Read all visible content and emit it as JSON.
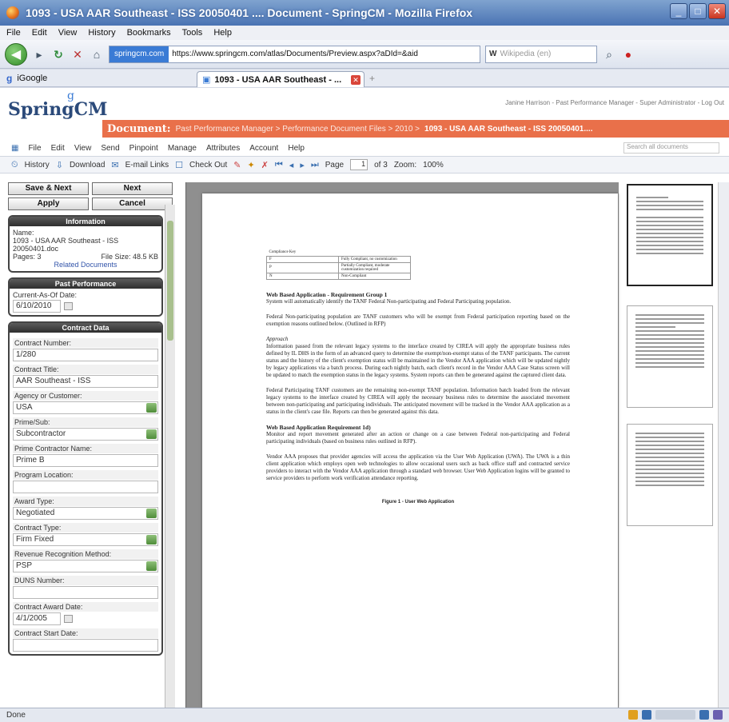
{
  "window": {
    "title": "1093 - USA AAR Southeast - ISS 20050401 .... Document - SpringCM - Mozilla Firefox"
  },
  "menu": [
    "File",
    "Edit",
    "View",
    "History",
    "Bookmarks",
    "Tools",
    "Help"
  ],
  "nav": {
    "site_identity": "springcm.com",
    "url": "https://www.springcm.com/atlas/Documents/Preview.aspx?aDId=&aid",
    "search_engine_letter": "W",
    "search_placeholder": "Wikipedia (en)"
  },
  "bookmarks": {
    "google_label": "iGoogle"
  },
  "tab": {
    "label": "1093 - USA AAR Southeast - ...",
    "new_tab": "+"
  },
  "app": {
    "user_links": "Janine Harrison - Past Performance Manager - Super Administrator - Log Out",
    "logo": "SpringCM",
    "logo_mark": "g",
    "crumb_label": "Document:",
    "crumb_path": "Past Performance Manager > Performance Document Files > 2010 > ",
    "crumb_current": "1093 - USA AAR Southeast - ISS 20050401....",
    "menu": [
      "File",
      "Edit",
      "View",
      "Send",
      "Pinpoint",
      "Manage",
      "Attributes",
      "Account",
      "Help"
    ],
    "quicksearch_placeholder": "Search all documents",
    "toolbar": {
      "history": "History",
      "download": "Download",
      "email": "E-mail Links",
      "checkout": "Check Out",
      "page_label": "Page",
      "page_value": "1",
      "page_of": "of 3",
      "zoom_label": "Zoom:",
      "zoom_value": "100%"
    }
  },
  "sidebar": {
    "save_next": "Save & Next",
    "next": "Next",
    "apply": "Apply",
    "cancel": "Cancel",
    "info_head": "Information",
    "name_label": "Name:",
    "name_value": "1093 - USA AAR Southeast - ISS 20050401.doc",
    "pages_label": "Pages: 3",
    "file_size": "File Size: 48.5 KB",
    "related": "Related Documents",
    "pp_head": "Past Performance",
    "current_as_of_label": "Current-As-Of Date:",
    "current_as_of_value": "6/10/2010",
    "cd_head": "Contract Data",
    "fields": [
      {
        "label": "Contract Number:",
        "value": "1/280",
        "dropdown": false
      },
      {
        "label": "Contract Title:",
        "value": "AAR Southeast - ISS",
        "dropdown": false
      },
      {
        "label": "Agency or Customer:",
        "value": "USA",
        "dropdown": true
      },
      {
        "label": "Prime/Sub:",
        "value": "Subcontractor",
        "dropdown": true
      },
      {
        "label": "Prime Contractor Name:",
        "value": "Prime B",
        "dropdown": false
      },
      {
        "label": "Program Location:",
        "value": "",
        "dropdown": false
      },
      {
        "label": "Award Type:",
        "value": "Negotiated",
        "dropdown": true
      },
      {
        "label": "Contract Type:",
        "value": "Firm Fixed",
        "dropdown": true
      },
      {
        "label": "Revenue Recognition Method:",
        "value": "PSP",
        "dropdown": true
      },
      {
        "label": "DUNS Number:",
        "value": "",
        "dropdown": false
      },
      {
        "label": "Contract Award Date:",
        "value": "4/1/2005",
        "dropdown": false
      },
      {
        "label": "Contract Start Date:",
        "value": "",
        "dropdown": false
      }
    ]
  },
  "document": {
    "table_head": "Compliance Key",
    "table_rows": [
      [
        "F",
        "Fully Compliant, no customization"
      ],
      [
        "P",
        "Partially Compliant, moderate customization required"
      ],
      [
        "N",
        "Non-Compliant"
      ]
    ],
    "h1": "Web Based Application - Requirement Group 1",
    "p1": "System will automatically identify the TANF Federal Non-participating and Federal Participating population.",
    "p2": "Federal Non-participating population are TANF customers who will be exempt from Federal participation reporting based on the exemption reasons outlined below. (Outlined in RFP)",
    "approach": "Approach",
    "p3": "Information passed from the relevant legacy systems to the interface created by CIREA will apply the appropriate business rules defined by IL DHS in the form of an advanced query to determine the exempt/non-exempt status of the TANF participants. The current status and the history of the client's exemption status will be maintained in the Vendor AAA application which will be updated nightly by legacy applications via a batch process. During each nightly batch, each client's record in the Vendor AAA Case Status screen will be updated to match the exemption status in the legacy systems. System reports can then be generated against the captured client data.",
    "p4": "Federal Participating TANF customers are the remaining non-exempt TANF population. Information batch loaded from the relevant legacy systems to the interface created by CIREA will apply the necessary business rules to determine the associated movement between non-participating and participating individuals. The anticipated movement will be tracked in the Vendor AAA application as a status in the client's case file. Reports can then be generated against this data.",
    "h2": "Web Based Application Requirement 1d)",
    "p5": "Monitor and report movement generated after an action or change on a case between Federal non-participating and Federal participating individuals (based on business rules outlined in RFP).",
    "p6": "Vendor AAA proposes that provider agencies will access the application via the User Web Application (UWA). The UWA is a thin client application which employs open web technologies to allow occasional users such as back office staff and contracted service providers to interact with the Vendor AAA application through a standard web browser. User Web Application logins will be granted to service providers to perform work verification attendance reporting.",
    "figure_caption": "Figure 1 - User Web Application"
  },
  "status": {
    "text": "Done"
  },
  "colors": {
    "crumb_bar": "#e9704a",
    "title_bar": "#4a73b3"
  }
}
